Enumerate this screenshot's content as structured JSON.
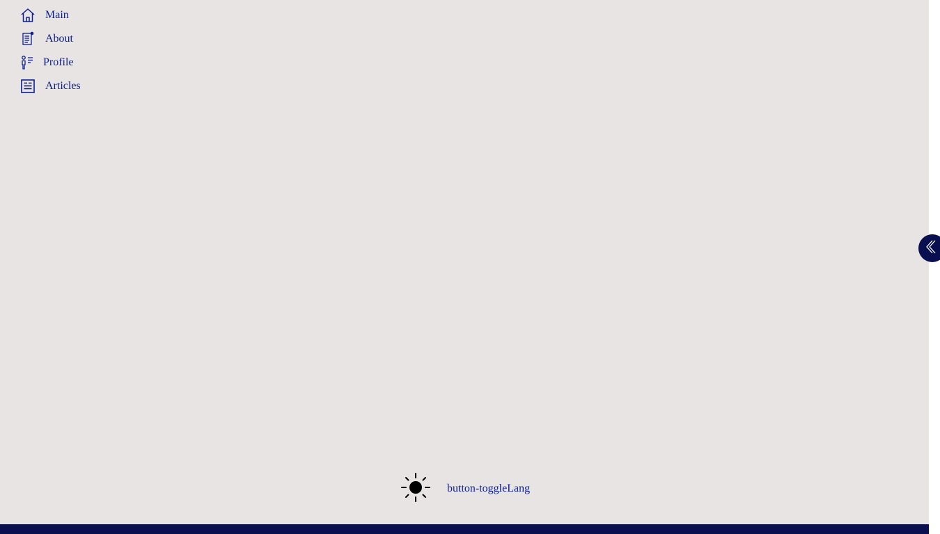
{
  "sidebar": {
    "items": [
      {
        "label": "Main",
        "icon": "home-icon"
      },
      {
        "label": "About",
        "icon": "document-icon"
      },
      {
        "label": "Profile",
        "icon": "profile-icon"
      },
      {
        "label": "Articles",
        "icon": "articles-icon"
      }
    ],
    "collapse_icon": "chevron-left-icon"
  },
  "footer": {
    "theme_icon": "sun-icon",
    "lang_button_label": "button-toggleLang"
  },
  "colors": {
    "sidebar_bg": "#e8e4e4",
    "accent_text": "#0b1f8f",
    "dark_navy": "#0a0f50"
  }
}
